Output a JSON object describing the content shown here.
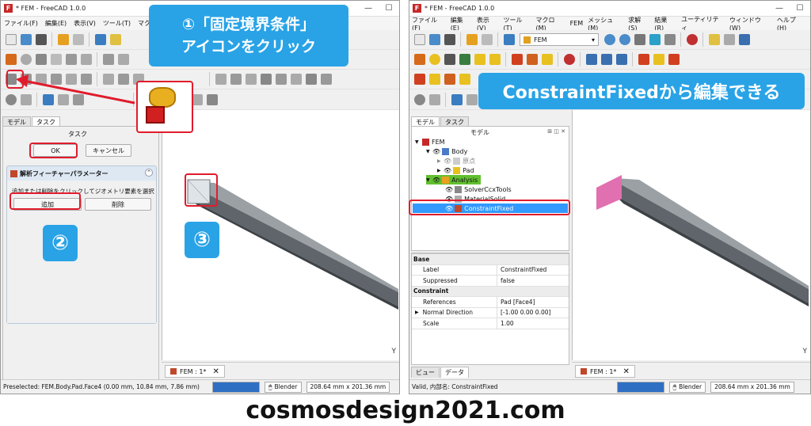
{
  "window_title": "* FEM - FreeCAD 1.0.0",
  "left_menu": [
    "ファイル(F)",
    "編集(E)",
    "表示(V)",
    "ツール(T)",
    "マクロ(M)"
  ],
  "right_menu": [
    "ファイル(F)",
    "編集(E)",
    "表示(V)",
    "ツール(T)",
    "マクロ(M)",
    "FEM",
    "メッシュ(M)",
    "求解(S)",
    "結果(R)",
    "ユーティリティ",
    "ウィンドウ(W)",
    "ヘルプ(H)"
  ],
  "workbench": "FEM",
  "annot": {
    "step1_l1": "①「固定境界条件」",
    "step1_l2": "アイコンをクリック",
    "step2": "②",
    "step3": "③",
    "right": "ConstraintFixedから編集できる"
  },
  "left_panel": {
    "tabs": [
      "モデル",
      "タスク"
    ],
    "task_heading": "タスク",
    "ok": "OK",
    "cancel": "キャンセル",
    "section_title": "解析フィーチャーパラメーター",
    "instruction": "追加または削除をクリックしてジオメトリ要素を選択",
    "add": "追加",
    "remove": "削除"
  },
  "right_panel": {
    "tabs": [
      "モデル",
      "タスク"
    ],
    "heading": "モデル",
    "tree": [
      {
        "label": "FEM",
        "level": 0
      },
      {
        "label": "Body",
        "level": 1
      },
      {
        "label": "原点",
        "level": 2
      },
      {
        "label": "Pad",
        "level": 2
      },
      {
        "label": "Analysis",
        "level": 1
      },
      {
        "label": "SolverCcxTools",
        "level": 2
      },
      {
        "label": "MaterialSolid",
        "level": 2
      },
      {
        "label": "ConstraintFixed",
        "level": 2
      }
    ],
    "props": {
      "group1": "Base",
      "label_k": "Label",
      "label_v": "ConstraintFixed",
      "supp_k": "Suppressed",
      "supp_v": "false",
      "group2": "Constraint",
      "ref_k": "References",
      "ref_v": "Pad [Face4]",
      "nd_k": "Normal Direction",
      "nd_v": "[-1.00 0.00 0.00]",
      "scale_k": "Scale",
      "scale_v": "1.00"
    },
    "bottom_tabs": [
      "ビュー",
      "データ"
    ]
  },
  "doc_tab": "FEM : 1*",
  "status_left": "Preselected: FEM.Body.Pad.Face4 (0.00 mm, 10.84 mm, 7.86 mm)",
  "status_right": "Valid, 内部名: ConstraintFixed",
  "nav_style": "Blender",
  "dims": "208.64 mm x 201.36 mm",
  "axis_label": "Y",
  "website": "cosmosdesign2021.com"
}
